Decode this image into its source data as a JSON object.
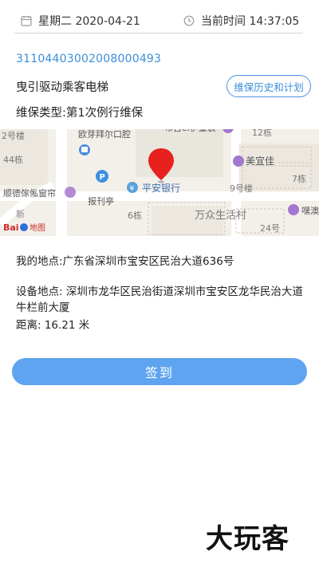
{
  "header": {
    "date_text": "星期二 2020-04-21",
    "time_text": "当前时间 14:37:05",
    "calendar_icon": "calendar-icon",
    "clock_icon": "clock-icon"
  },
  "equipment": {
    "code": "31104403002008000493",
    "name": "曳引驱动乘客电梯",
    "history_button": "维保历史和计划",
    "maintenance_type": "维保类型:第1次例行维保"
  },
  "map": {
    "logo": "Bai地图",
    "labels": [
      "2号楼",
      "44栋",
      "欧芽拜尔口腔",
      "布吉ei伊童装",
      "12栋",
      "美宜佳",
      "7栋",
      "顺德傢俬窗帘",
      "平安银行",
      "9号楼",
      "报刊亭",
      "6栋",
      "万众生活村",
      "嘿澳",
      "24号",
      "新"
    ]
  },
  "location": {
    "my_location": "我的地点:广东省深圳市宝安区民治大道636号",
    "device_location": "设备地点: 深圳市龙华区民治街道深圳市宝安区龙华民治大道牛栏前大厦",
    "distance": "距离: 16.21 米"
  },
  "actions": {
    "signin_label": "签到"
  },
  "watermark": {
    "text": "大玩客"
  }
}
